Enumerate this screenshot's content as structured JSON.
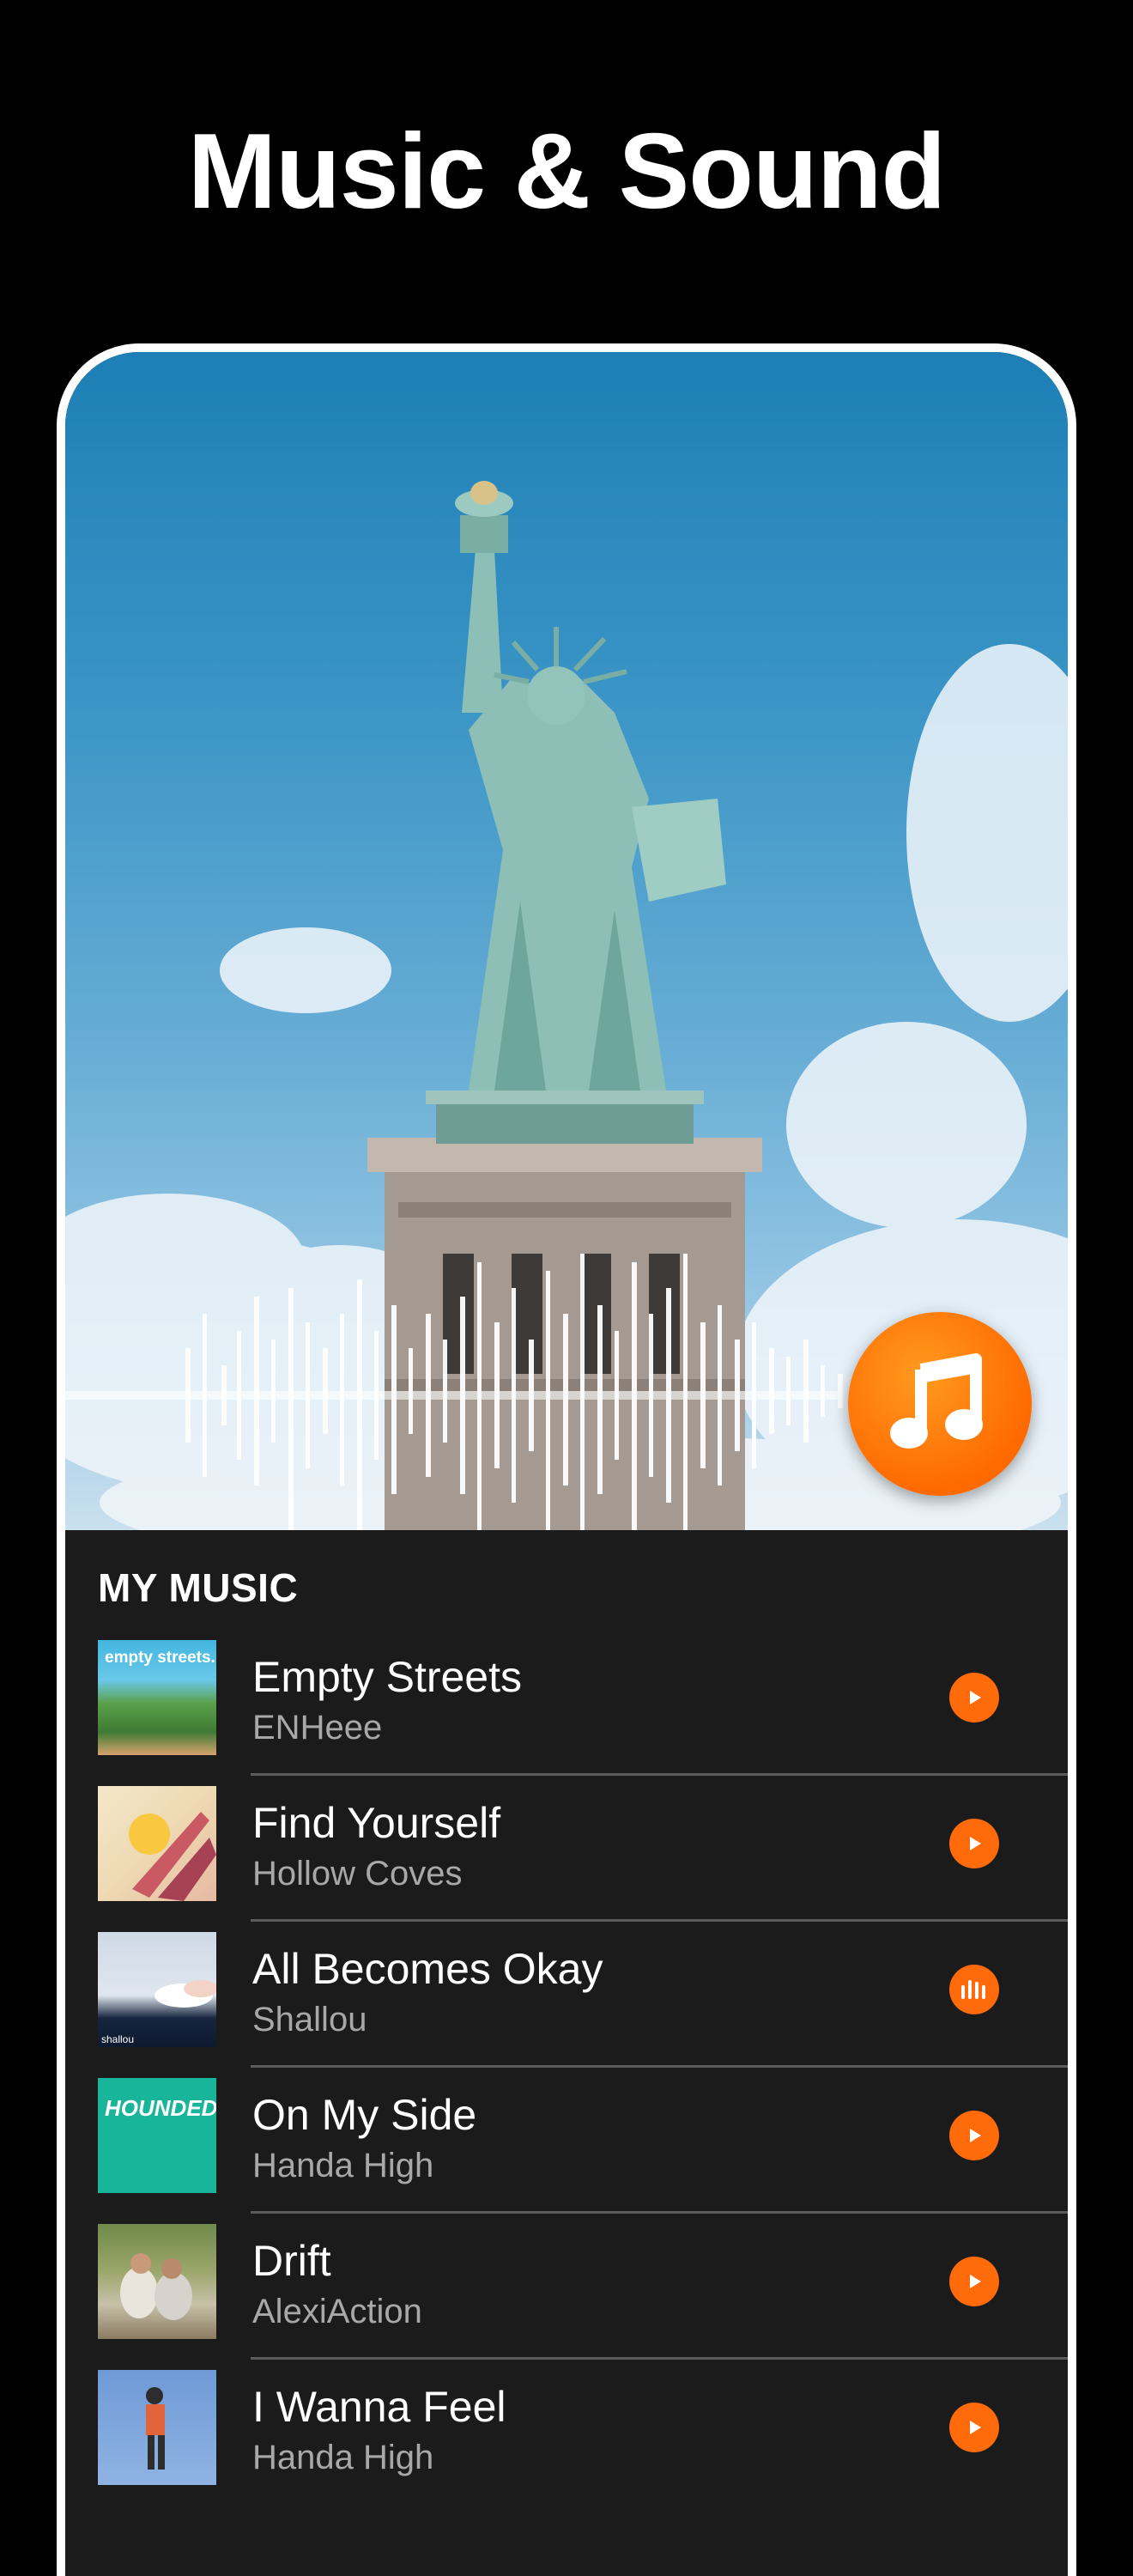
{
  "headline": "Music & Sound",
  "section": {
    "title": "MY MUSIC"
  },
  "colors": {
    "accent": "#ff6a0a",
    "background": "#000000",
    "panel": "#1b1b1b"
  },
  "fab": {
    "icon": "music-note-icon"
  },
  "tracks": [
    {
      "title": "Empty Streets",
      "artist": "ENHeee",
      "action_icon": "play-icon",
      "cover_text": "empty streets."
    },
    {
      "title": "Find Yourself",
      "artist": "Hollow  Coves",
      "action_icon": "play-icon",
      "cover_text": ""
    },
    {
      "title": "All Becomes Okay",
      "artist": "Shallou",
      "action_icon": "equalizer-icon",
      "cover_text": "shallou"
    },
    {
      "title": "On My Side",
      "artist": "Handa High",
      "action_icon": "play-icon",
      "cover_text": "HOUNDED"
    },
    {
      "title": "Drift",
      "artist": "AlexiAction",
      "action_icon": "play-icon",
      "cover_text": ""
    },
    {
      "title": "I Wanna Feel",
      "artist": "Handa High",
      "action_icon": "play-icon",
      "cover_text": ""
    }
  ]
}
